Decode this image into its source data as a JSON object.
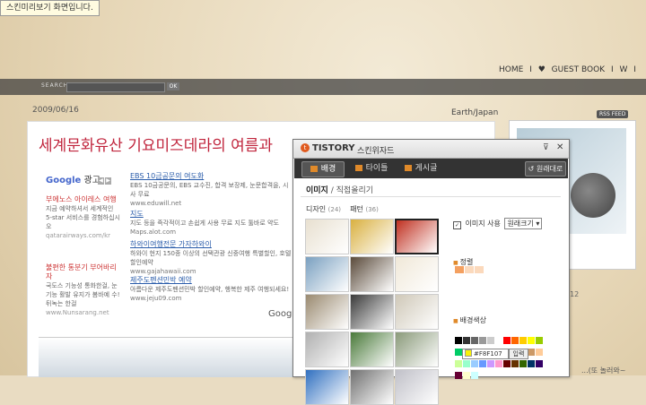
{
  "tooltip": "스킨미리보기 화면입니다.",
  "blog": {
    "nav": [
      "HOME",
      "I",
      "♥",
      "GUEST BOOK",
      "I",
      "W",
      "I"
    ],
    "search_label": "SEARCH",
    "search_ok": "OK",
    "sub_text": "2009/06/16",
    "category": "Earth/Japan",
    "rss": "RSS FEED",
    "post_title": "세계문화유산 기요미즈데라의 여름과",
    "ads_brand": "Google",
    "ads_label": "광고",
    "right_caption": "...(또 놀러와~",
    "side_items": [
      "212",
      "1"
    ]
  },
  "ads_left": [
    {
      "title": "부에노스 아이레스 여행",
      "desc": "지금 예약하셔서 세계적인 5-star 서비스를 경험하십시오",
      "url": "qatarairways.com/kr"
    },
    {
      "title": "불편한 통분기 부어바리자",
      "desc": "국도스 기능성 통화한걸, 눈기능 활발 유지가 봄바예 수! 뒤녹는 한걸",
      "url": "www.Nunsarang.net"
    }
  ],
  "ads_right": [
    {
      "title": "EBS 10금공문의 여도화",
      "desc": "EBS 10금공문의, EBS 교수진, 합격 보장제, 눈문합격을, 시사 무료",
      "url": "www.eduwill.net"
    },
    {
      "title": "지도",
      "desc": "지도 등을 즉각적이고 손쉽게 사용 무료 지도 툴바로 약도",
      "url": "Maps.alot.com"
    },
    {
      "title": "하와이여행전문 가자하와이",
      "desc": "하와이 현지 150종 이상의 선택관광 신중여행 특별할인, 호텔 할인예약",
      "url": "www.gajahawaii.com"
    },
    {
      "title": "제주도펜션민박 예약",
      "desc": "아름다운 제주도펜션민박 할인예약, 행복한 제주 여행되세요!",
      "url": "www.jeju09.com"
    }
  ],
  "google_footer": "Google",
  "wizard": {
    "brand": "TISTORY",
    "title": "스킨위자드",
    "tabs": [
      "배경",
      "타이틀",
      "게시글"
    ],
    "reset": "원래대로",
    "subtabs": [
      "이미지",
      "/",
      "직접올리기"
    ],
    "filter_design": "디자인",
    "filter_design_count": "(24)",
    "filter_pattern": "패턴",
    "filter_pattern_count": "(36)",
    "use_image_label": "이미지 사용",
    "size_option": "원래크기",
    "align_label": "정렬",
    "bgcolor_label": "배경색상",
    "hex_value": "#F8F107",
    "apply": "입력",
    "palette": [
      "#000000",
      "#333333",
      "#666666",
      "#999999",
      "#cccccc",
      "#ffffff",
      "#ff0000",
      "#ff6600",
      "#ffcc00",
      "#ffff00",
      "#99cc00",
      "#00cc66",
      "#00cccc",
      "#0066cc",
      "#3333cc",
      "#9933cc",
      "#cc3399",
      "#ff6699",
      "#993300",
      "#996633",
      "#cc9966",
      "#ffcc99",
      "#ccff99",
      "#99ffcc",
      "#99ccff",
      "#6699ff",
      "#cc99ff",
      "#ff99cc",
      "#660000",
      "#663300",
      "#336600",
      "#003366",
      "#330066",
      "#660033",
      "#ffffcc",
      "#ccffff"
    ],
    "thumbs": [
      "#e8e0d0",
      "#d9b040",
      "#c03020",
      "#7aa0c0",
      "#5a4a3a",
      "#f0e8d8",
      "#9a8a70",
      "#3a3a3a",
      "#cfc8b8",
      "#b0b0b0",
      "#4a7a3a",
      "#8a9a7a",
      "#3070c0",
      "#707070",
      "#c0c0c8"
    ]
  },
  "colors": {
    "accent": "#c0243c",
    "wizard_orange": "#e08a2a"
  }
}
